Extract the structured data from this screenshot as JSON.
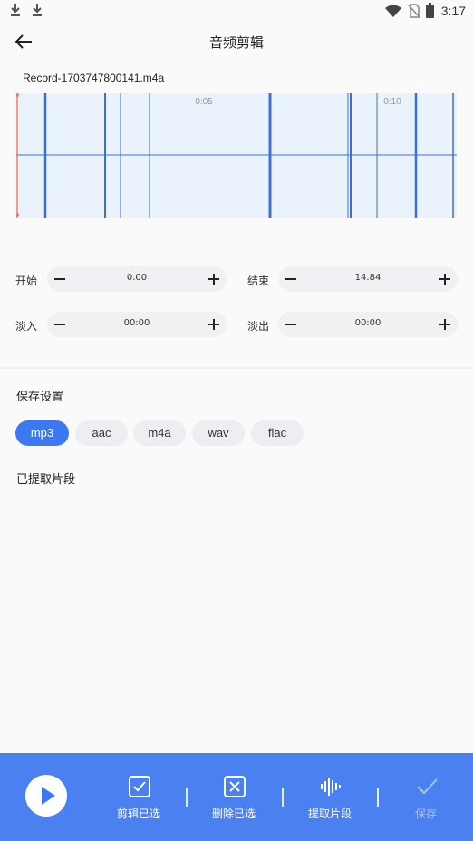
{
  "status_bar": {
    "time": "3:17"
  },
  "header": {
    "title": "音频剪辑",
    "back_icon": "arrow-left-icon"
  },
  "file": {
    "name": "Record-1703747800141.m4a"
  },
  "waveform": {
    "time_markers": [
      "0:05",
      "0:10"
    ]
  },
  "controls": {
    "start": {
      "label": "开始",
      "value": "0.00"
    },
    "end": {
      "label": "结束",
      "value": "14.84"
    },
    "fade_in": {
      "label": "淡入",
      "value": "00:00"
    },
    "fade_out": {
      "label": "淡出",
      "value": "00:00"
    }
  },
  "save_settings": {
    "title": "保存设置",
    "formats": [
      "mp3",
      "aac",
      "m4a",
      "wav",
      "flac"
    ],
    "selected": "mp3"
  },
  "extracted": {
    "title": "已提取片段"
  },
  "bottom_bar": {
    "play_icon": "play-icon",
    "actions": [
      {
        "label": "剪辑已选",
        "icon": "checkbox-icon"
      },
      {
        "label": "删除已选",
        "icon": "delete-box-icon"
      },
      {
        "label": "提取片段",
        "icon": "waveform-icon"
      },
      {
        "label": "保存",
        "icon": "checkmark-icon"
      }
    ]
  },
  "colors": {
    "accent": "#3d78f0",
    "bottom_bar": "#4a80f0",
    "waveform_line": "#3d6fd6",
    "waveform_bg": "#eaf3fc",
    "playhead": "#f07e6e"
  }
}
